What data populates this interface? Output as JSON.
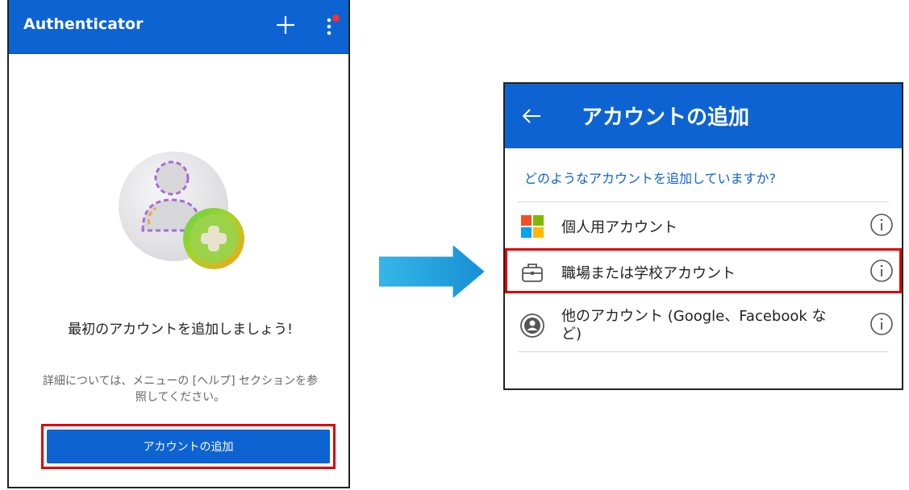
{
  "left": {
    "app_title": "Authenticator",
    "plus_icon": "plus-icon",
    "more_icon": "more-vertical-icon",
    "first_account_title": "最初のアカウントを追加しましょう!",
    "help_text": "詳細については、メニューの [ヘルプ] セクションを参照してください。",
    "add_button_label": "アカウントの追加",
    "accent_color": "#0d63d1",
    "highlight_color": "#e00000"
  },
  "right": {
    "back_icon": "back-arrow-icon",
    "title": "アカウントの追加",
    "question": "どのようなアカウントを追加していますか?",
    "options": [
      {
        "label": "個人用アカウント",
        "icon": "microsoft-logo-icon"
      },
      {
        "label": "職場または学校アカウント",
        "icon": "briefcase-icon"
      },
      {
        "label": "他のアカウント (Google、Facebook など)",
        "icon": "user-circle-icon"
      }
    ],
    "info_icon": "info-icon"
  }
}
